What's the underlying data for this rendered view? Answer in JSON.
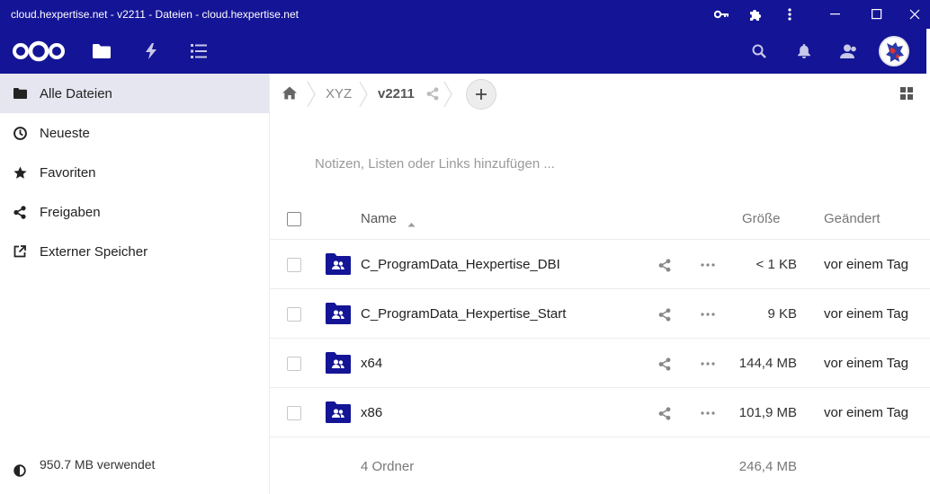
{
  "window": {
    "title": "cloud.hexpertise.net - v2211 - Dateien - cloud.hexpertise.net",
    "buttons": [
      "key-icon",
      "extension-icon",
      "more-vertical-icon",
      "minimize-icon",
      "maximize-icon",
      "close-icon"
    ]
  },
  "header": {
    "apps": [
      "files-icon",
      "activity-icon",
      "tasks-icon"
    ],
    "right_icons": [
      "search-icon",
      "bell-icon",
      "contacts-icon"
    ]
  },
  "sidebar": {
    "items": [
      {
        "label": "Alle Dateien",
        "icon": "folder-icon",
        "active": true
      },
      {
        "label": "Neueste",
        "icon": "clock-icon",
        "active": false
      },
      {
        "label": "Favoriten",
        "icon": "star-icon",
        "active": false
      },
      {
        "label": "Freigaben",
        "icon": "share-icon",
        "active": false
      },
      {
        "label": "Externer Speicher",
        "icon": "external-link-icon",
        "active": false
      }
    ],
    "quota": "950.7 MB verwendet"
  },
  "breadcrumb": {
    "items": [
      "XYZ",
      "v2211"
    ]
  },
  "notes": {
    "placeholder": "Notizen, Listen oder Links hinzufügen ..."
  },
  "table": {
    "columns": {
      "name": "Name",
      "size": "Größe",
      "modified": "Geändert"
    },
    "rows": [
      {
        "name": "C_ProgramData_Hexpertise_DBI",
        "size": "< 1 KB",
        "modified": "vor einem Tag"
      },
      {
        "name": "C_ProgramData_Hexpertise_Start",
        "size": "9 KB",
        "modified": "vor einem Tag"
      },
      {
        "name": "x64",
        "size": "144,4 MB",
        "modified": "vor einem Tag"
      },
      {
        "name": "x86",
        "size": "101,9 MB",
        "modified": "vor einem Tag"
      }
    ],
    "summary": {
      "count": "4 Ordner",
      "size": "246,4 MB"
    }
  },
  "colors": {
    "brand": "#141496",
    "active_nav": "#e6e6f0",
    "folder": "#141496"
  }
}
